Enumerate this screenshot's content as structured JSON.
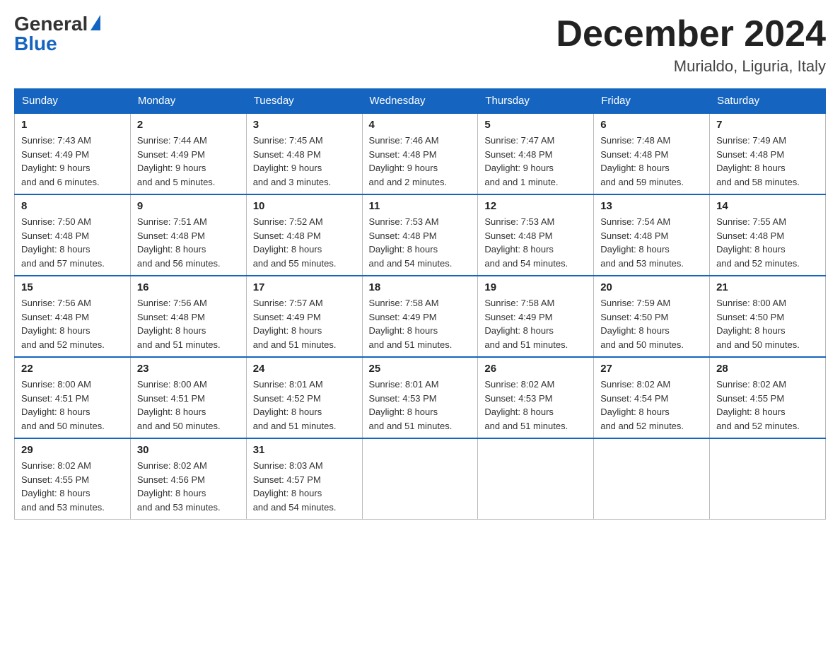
{
  "header": {
    "logo_general": "General",
    "logo_blue": "Blue",
    "month_title": "December 2024",
    "location": "Murialdo, Liguria, Italy"
  },
  "weekdays": [
    "Sunday",
    "Monday",
    "Tuesday",
    "Wednesday",
    "Thursday",
    "Friday",
    "Saturday"
  ],
  "weeks": [
    [
      {
        "day": "1",
        "sunrise": "7:43 AM",
        "sunset": "4:49 PM",
        "daylight": "9 hours and 6 minutes."
      },
      {
        "day": "2",
        "sunrise": "7:44 AM",
        "sunset": "4:49 PM",
        "daylight": "9 hours and 5 minutes."
      },
      {
        "day": "3",
        "sunrise": "7:45 AM",
        "sunset": "4:48 PM",
        "daylight": "9 hours and 3 minutes."
      },
      {
        "day": "4",
        "sunrise": "7:46 AM",
        "sunset": "4:48 PM",
        "daylight": "9 hours and 2 minutes."
      },
      {
        "day": "5",
        "sunrise": "7:47 AM",
        "sunset": "4:48 PM",
        "daylight": "9 hours and 1 minute."
      },
      {
        "day": "6",
        "sunrise": "7:48 AM",
        "sunset": "4:48 PM",
        "daylight": "8 hours and 59 minutes."
      },
      {
        "day": "7",
        "sunrise": "7:49 AM",
        "sunset": "4:48 PM",
        "daylight": "8 hours and 58 minutes."
      }
    ],
    [
      {
        "day": "8",
        "sunrise": "7:50 AM",
        "sunset": "4:48 PM",
        "daylight": "8 hours and 57 minutes."
      },
      {
        "day": "9",
        "sunrise": "7:51 AM",
        "sunset": "4:48 PM",
        "daylight": "8 hours and 56 minutes."
      },
      {
        "day": "10",
        "sunrise": "7:52 AM",
        "sunset": "4:48 PM",
        "daylight": "8 hours and 55 minutes."
      },
      {
        "day": "11",
        "sunrise": "7:53 AM",
        "sunset": "4:48 PM",
        "daylight": "8 hours and 54 minutes."
      },
      {
        "day": "12",
        "sunrise": "7:53 AM",
        "sunset": "4:48 PM",
        "daylight": "8 hours and 54 minutes."
      },
      {
        "day": "13",
        "sunrise": "7:54 AM",
        "sunset": "4:48 PM",
        "daylight": "8 hours and 53 minutes."
      },
      {
        "day": "14",
        "sunrise": "7:55 AM",
        "sunset": "4:48 PM",
        "daylight": "8 hours and 52 minutes."
      }
    ],
    [
      {
        "day": "15",
        "sunrise": "7:56 AM",
        "sunset": "4:48 PM",
        "daylight": "8 hours and 52 minutes."
      },
      {
        "day": "16",
        "sunrise": "7:56 AM",
        "sunset": "4:48 PM",
        "daylight": "8 hours and 51 minutes."
      },
      {
        "day": "17",
        "sunrise": "7:57 AM",
        "sunset": "4:49 PM",
        "daylight": "8 hours and 51 minutes."
      },
      {
        "day": "18",
        "sunrise": "7:58 AM",
        "sunset": "4:49 PM",
        "daylight": "8 hours and 51 minutes."
      },
      {
        "day": "19",
        "sunrise": "7:58 AM",
        "sunset": "4:49 PM",
        "daylight": "8 hours and 51 minutes."
      },
      {
        "day": "20",
        "sunrise": "7:59 AM",
        "sunset": "4:50 PM",
        "daylight": "8 hours and 50 minutes."
      },
      {
        "day": "21",
        "sunrise": "8:00 AM",
        "sunset": "4:50 PM",
        "daylight": "8 hours and 50 minutes."
      }
    ],
    [
      {
        "day": "22",
        "sunrise": "8:00 AM",
        "sunset": "4:51 PM",
        "daylight": "8 hours and 50 minutes."
      },
      {
        "day": "23",
        "sunrise": "8:00 AM",
        "sunset": "4:51 PM",
        "daylight": "8 hours and 50 minutes."
      },
      {
        "day": "24",
        "sunrise": "8:01 AM",
        "sunset": "4:52 PM",
        "daylight": "8 hours and 51 minutes."
      },
      {
        "day": "25",
        "sunrise": "8:01 AM",
        "sunset": "4:53 PM",
        "daylight": "8 hours and 51 minutes."
      },
      {
        "day": "26",
        "sunrise": "8:02 AM",
        "sunset": "4:53 PM",
        "daylight": "8 hours and 51 minutes."
      },
      {
        "day": "27",
        "sunrise": "8:02 AM",
        "sunset": "4:54 PM",
        "daylight": "8 hours and 52 minutes."
      },
      {
        "day": "28",
        "sunrise": "8:02 AM",
        "sunset": "4:55 PM",
        "daylight": "8 hours and 52 minutes."
      }
    ],
    [
      {
        "day": "29",
        "sunrise": "8:02 AM",
        "sunset": "4:55 PM",
        "daylight": "8 hours and 53 minutes."
      },
      {
        "day": "30",
        "sunrise": "8:02 AM",
        "sunset": "4:56 PM",
        "daylight": "8 hours and 53 minutes."
      },
      {
        "day": "31",
        "sunrise": "8:03 AM",
        "sunset": "4:57 PM",
        "daylight": "8 hours and 54 minutes."
      },
      null,
      null,
      null,
      null
    ]
  ],
  "labels": {
    "sunrise": "Sunrise:",
    "sunset": "Sunset:",
    "daylight": "Daylight:"
  }
}
